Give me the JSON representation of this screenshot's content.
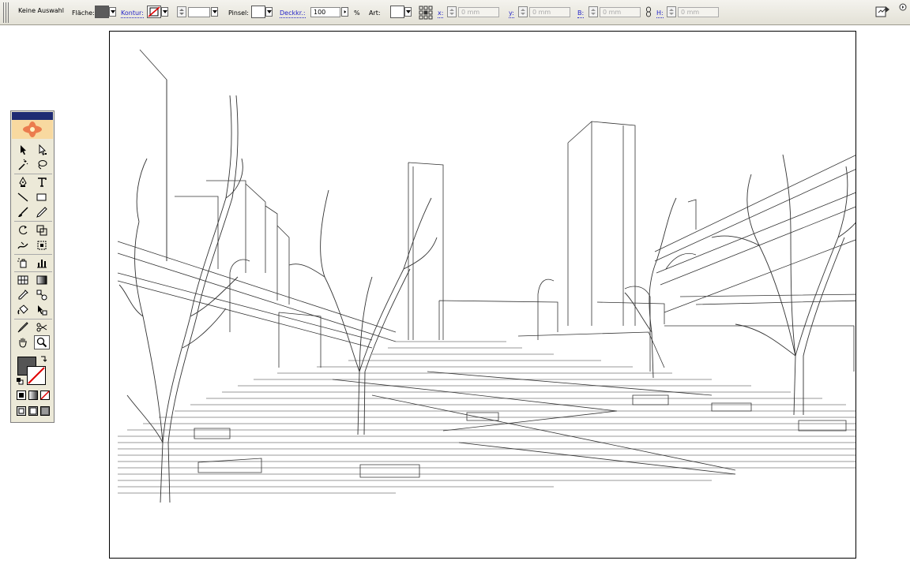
{
  "controlbar": {
    "selection": "Keine Auswahl",
    "fill_label": "Fläche:",
    "stroke_label": "Kontur:",
    "brush_label": "Pinsel:",
    "opacity_label": "Deckkr.:",
    "opacity_value": "100",
    "percent": "%",
    "style_label": "Art:",
    "x_label": "x:",
    "x_value": "0 mm",
    "y_label": "y:",
    "y_value": "0 mm",
    "w_label": "B:",
    "w_value": "0 mm",
    "h_label": "H:",
    "h_value": "0 mm"
  },
  "colors": {
    "toolbar_bg": "#e3e1d6",
    "palette_title": "#1f2b73",
    "link_blue": "#2727c8"
  },
  "icons": [
    "selection-icon",
    "direct-selection-icon",
    "magic-wand-icon",
    "lasso-icon",
    "pen-icon",
    "type-icon",
    "line-icon",
    "rectangle-icon",
    "paintbrush-icon",
    "pencil-icon",
    "rotate-icon",
    "scale-icon",
    "warp-icon",
    "free-transform-icon",
    "symbol-sprayer-icon",
    "graph-icon",
    "mesh-icon",
    "gradient-icon",
    "eyedropper-icon",
    "blend-icon",
    "live-paint-bucket-icon",
    "live-paint-selection-icon",
    "slice-icon",
    "scissors-icon",
    "hand-icon",
    "zoom-icon"
  ]
}
